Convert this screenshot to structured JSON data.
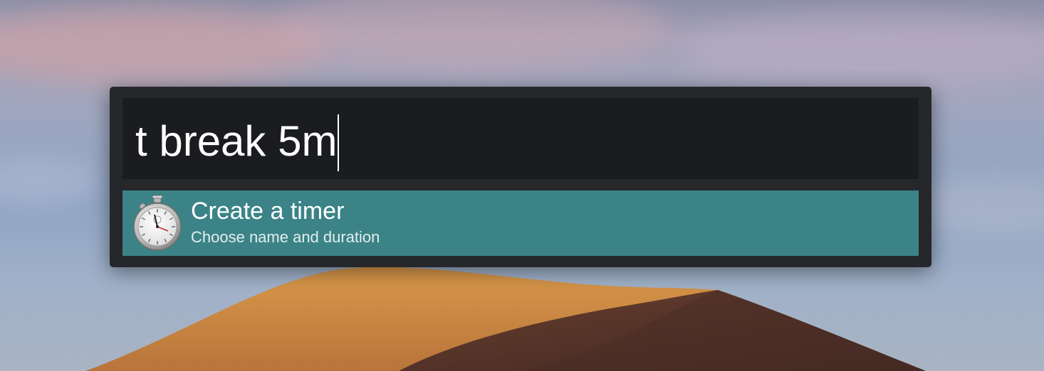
{
  "launcher": {
    "query": "t break 5m",
    "results": [
      {
        "title": "Create a timer",
        "subtitle": "Choose name and duration",
        "icon": "stopwatch-icon"
      }
    ]
  },
  "colors": {
    "panel": "#26272a",
    "query_box": "#1b1c1f",
    "selected_row": "#3b8387",
    "text": "#ffffff"
  }
}
